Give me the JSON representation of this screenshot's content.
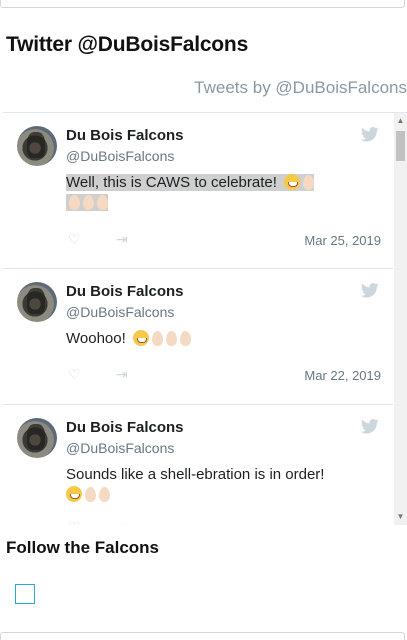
{
  "section": {
    "title": "Twitter @DuBoisFalcons"
  },
  "timeline": {
    "header": "Tweets by @DuBoisFalcons",
    "tweets": [
      {
        "name": "Du Bois Falcons",
        "handle": "@DuBoisFalcons",
        "text": "Well, this is CAWS to celebrate!",
        "emojis": [
          "grinning-face",
          "egg",
          "egg",
          "egg",
          "egg"
        ],
        "date": "Mar 25, 2019",
        "highlighted": true
      },
      {
        "name": "Du Bois Falcons",
        "handle": "@DuBoisFalcons",
        "text": "Woohoo!",
        "emojis": [
          "grinning-face",
          "egg",
          "egg",
          "egg"
        ],
        "date": "Mar 22, 2019",
        "highlighted": false
      },
      {
        "name": "Du Bois Falcons",
        "handle": "@DuBoisFalcons",
        "text": "Sounds like a shell-ebration is in order!",
        "emojis": [
          "grinning-face",
          "egg",
          "egg"
        ],
        "date": "",
        "highlighted": false
      }
    ]
  },
  "follow": {
    "title": "Follow the Falcons",
    "icon": "checkbox-icon"
  },
  "colors": {
    "twitter_blue": "#1da1f2",
    "handle_gray": "#697882",
    "border": "#e1e8ed"
  }
}
